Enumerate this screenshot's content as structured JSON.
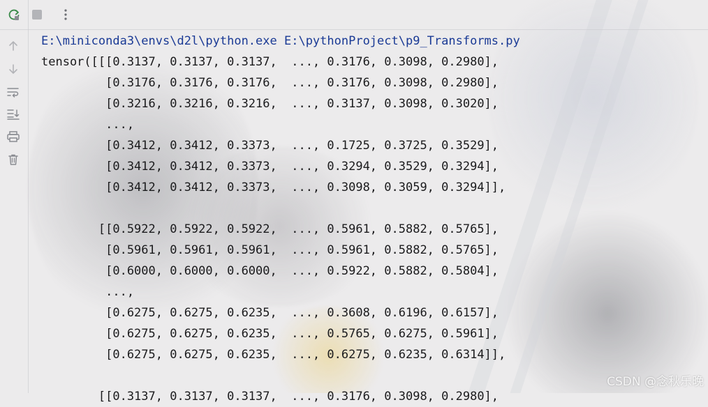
{
  "toolbar": {
    "top_icons": [
      "rerun-icon",
      "stop-icon",
      "more-options-icon"
    ],
    "left_icons": [
      "scroll-up-icon",
      "scroll-down-icon",
      "soft-wrap-icon",
      "scroll-to-end-icon",
      "print-icon",
      "clear-all-icon"
    ],
    "colors": {
      "rerun": "#3b8a4a",
      "icon": "#8a8c92",
      "icon_dim": "#b3b4b8"
    }
  },
  "console": {
    "lines": [
      "E:\\miniconda3\\envs\\d2l\\python.exe E:\\pythonProject\\p9_Transforms.py",
      "tensor([[[0.3137, 0.3137, 0.3137,  ..., 0.3176, 0.3098, 0.2980],",
      "         [0.3176, 0.3176, 0.3176,  ..., 0.3176, 0.3098, 0.2980],",
      "         [0.3216, 0.3216, 0.3216,  ..., 0.3137, 0.3098, 0.3020],",
      "         ...,",
      "         [0.3412, 0.3412, 0.3373,  ..., 0.1725, 0.3725, 0.3529],",
      "         [0.3412, 0.3412, 0.3373,  ..., 0.3294, 0.3529, 0.3294],",
      "         [0.3412, 0.3412, 0.3373,  ..., 0.3098, 0.3059, 0.3294]],",
      "",
      "        [[0.5922, 0.5922, 0.5922,  ..., 0.5961, 0.5882, 0.5765],",
      "         [0.5961, 0.5961, 0.5961,  ..., 0.5961, 0.5882, 0.5765],",
      "         [0.6000, 0.6000, 0.6000,  ..., 0.5922, 0.5882, 0.5804],",
      "         ...,",
      "         [0.6275, 0.6275, 0.6235,  ..., 0.3608, 0.6196, 0.6157],",
      "         [0.6275, 0.6275, 0.6235,  ..., 0.5765, 0.6275, 0.5961],",
      "         [0.6275, 0.6275, 0.6235,  ..., 0.6275, 0.6235, 0.6314]],",
      "",
      "        [[0.3137, 0.3137, 0.3137,  ..., 0.3176, 0.3098, 0.2980],"
    ],
    "colors": {
      "text": "#1b1b1d",
      "command": "#1a3a95"
    }
  },
  "watermark": {
    "text": "CSDN @念秋乐晚"
  }
}
